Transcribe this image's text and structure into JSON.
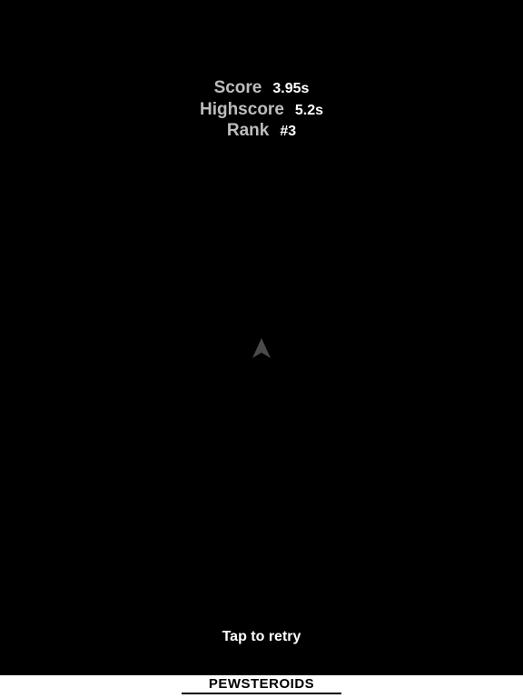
{
  "hud": {
    "score_label": "Score",
    "score_value": "3.95s",
    "highscore_label": "Highscore",
    "highscore_value": "5.2s",
    "rank_label": "Rank",
    "rank_value": "#3"
  },
  "game": {
    "retry_text": "Tap to retry",
    "ship_icon": "ship-arrow-icon",
    "ship_color": "#4a4a4a",
    "background_color": "#000000"
  },
  "footer": {
    "brand": "PEWSTEROIDS"
  }
}
